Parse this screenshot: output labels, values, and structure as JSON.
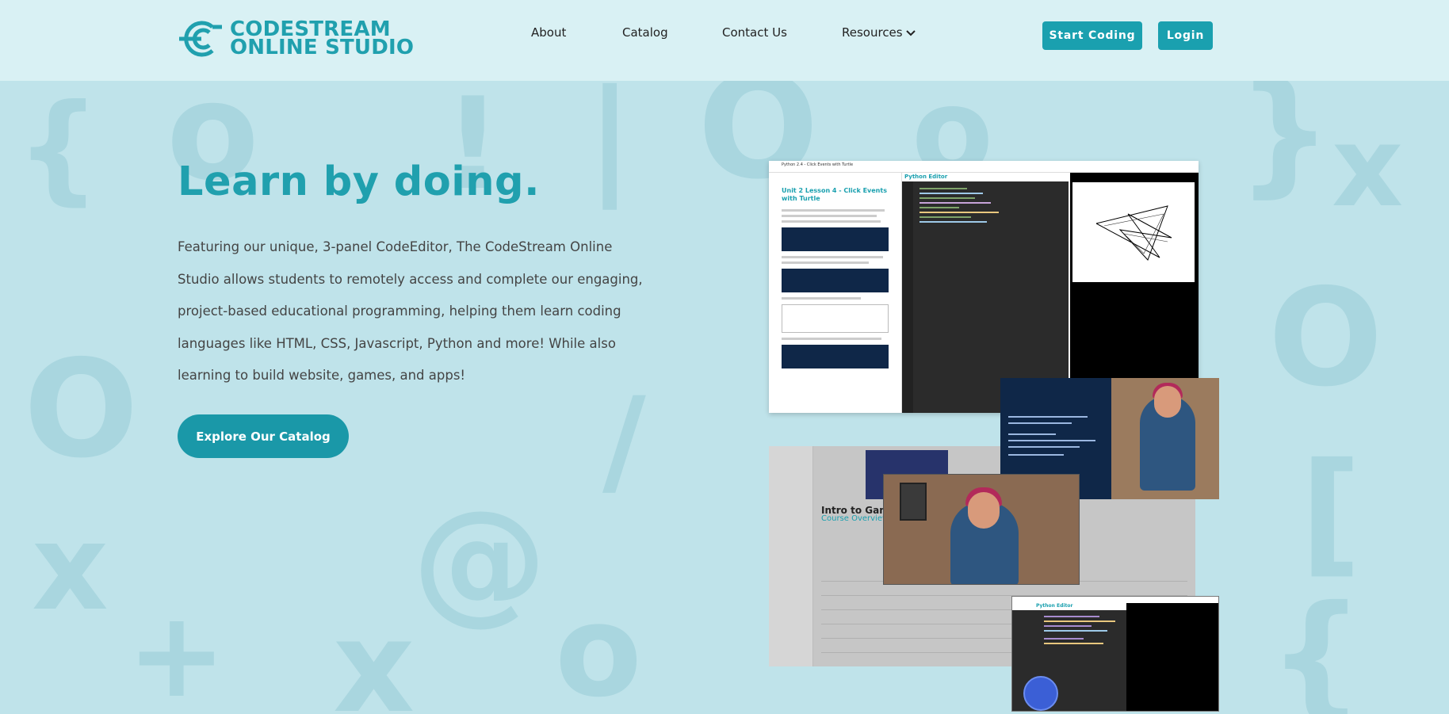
{
  "brand": {
    "logo_line1": "CODESTREAM",
    "logo_line2": "ONLINE STUDIO",
    "color": "#20a0ae"
  },
  "nav": {
    "items": [
      {
        "label": "About"
      },
      {
        "label": "Catalog"
      },
      {
        "label": "Contact Us"
      },
      {
        "label": "Resources",
        "icon": "chevron-down-icon"
      }
    ],
    "start_coding": "Start Coding",
    "login": "Login"
  },
  "hero": {
    "title": "Learn by doing.",
    "description": "Featuring our unique, 3-panel CodeEditor, The CodeStream Online Studio allows students to remotely access and complete our engaging, project-based educational programming, helping them learn coding languages like HTML, CSS, Javascript, Python and more! While also learning to build website, games, and apps!",
    "cta": "Explore Our Catalog"
  },
  "collage": {
    "editor_shot": {
      "title_bar": "Python 2.4 - Click Events with Turtle",
      "lesson_title": "Unit 2 Lesson 4 - Click Events with Turtle",
      "editor_header": "Python Editor"
    },
    "course_shot": {
      "title": "Intro to Game",
      "subtitle": "Course Overview"
    },
    "console_shot": {
      "editor_header": "Python Editor"
    }
  },
  "colors": {
    "accent": "#1aa0af",
    "background": "#bfe3ea",
    "header_bg": "#d9f1f4"
  }
}
